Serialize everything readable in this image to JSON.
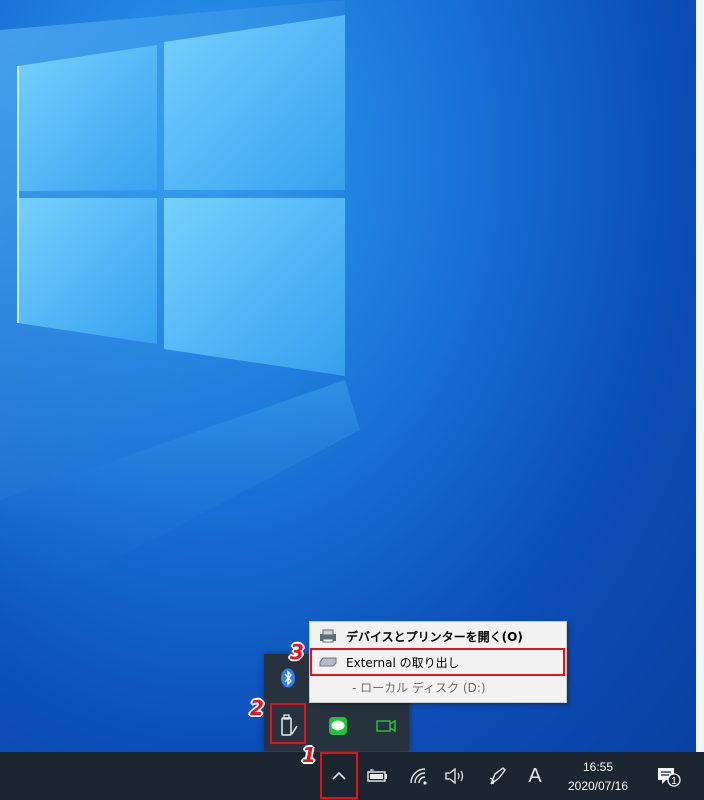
{
  "context_menu": {
    "items": [
      {
        "label": "デバイスとプリンターを開く(O)",
        "icon": "devices-printers-icon"
      },
      {
        "label": "External の取り出し",
        "icon": "drive-icon"
      },
      {
        "label": "- ローカル ディスク (D:)"
      }
    ]
  },
  "tray_flyout": {
    "icons": [
      "bluetooth-icon",
      "usb-drive-icon",
      "line-app-icon",
      "camera-icon"
    ]
  },
  "taskbar": {
    "chevron_icon": "chevron-up-icon",
    "system_icons": [
      "battery-icon",
      "wifi-icon",
      "volume-icon",
      "pen-icon"
    ],
    "ime_label": "A",
    "clock": {
      "time": "16:55",
      "date": "2020/07/16"
    },
    "notification_badge": "1"
  },
  "annotations": [
    "1",
    "2",
    "3"
  ],
  "colors": {
    "accent_red": "#e8101a",
    "taskbar": "#1c2631",
    "line_green": "#22c03c"
  }
}
